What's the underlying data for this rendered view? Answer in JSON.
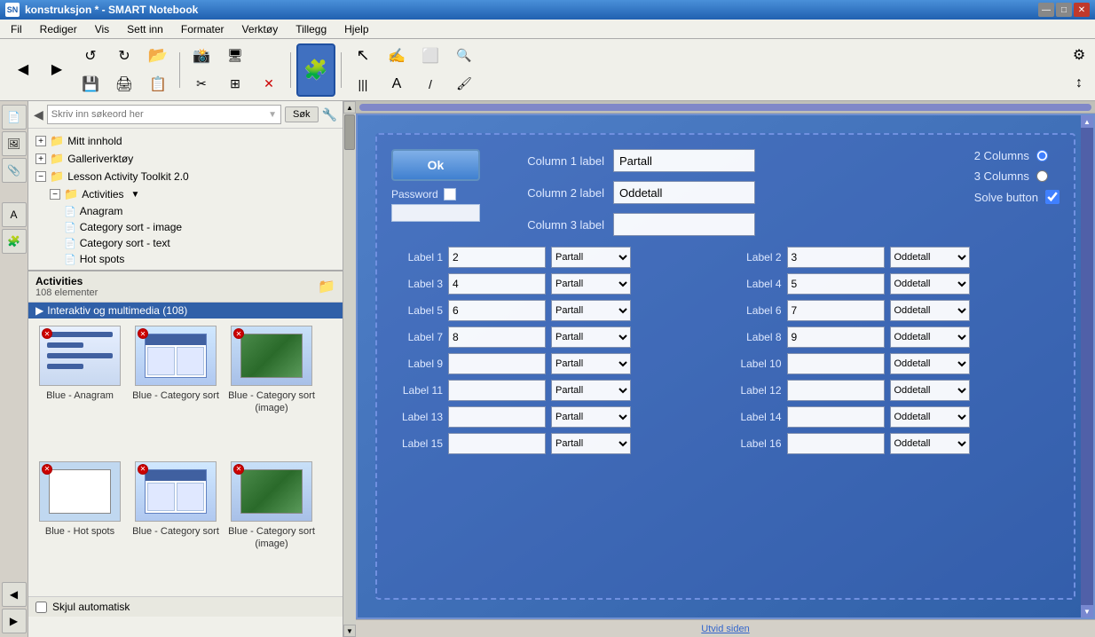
{
  "window": {
    "title": "konstruksjon * - SMART Notebook",
    "icon_label": "SN"
  },
  "titlebar": {
    "minimize_label": "—",
    "maximize_label": "□",
    "close_label": "✕"
  },
  "menu": {
    "items": [
      "Fil",
      "Rediger",
      "Vis",
      "Sett inn",
      "Formater",
      "Verktøy",
      "Tillegg",
      "Hjelp"
    ]
  },
  "toolbar": {
    "back_label": "◀",
    "forward_label": "▶",
    "nav_icons": [
      "↺",
      "↻",
      "📁",
      "💾",
      "✉",
      "🖨",
      "✂",
      "📋",
      "❌",
      "⊞",
      "✕"
    ],
    "tool_icons": [
      "↗",
      "✋",
      "⊕",
      "✎",
      "≡",
      "🖊",
      "A",
      "✎",
      "⚡"
    ],
    "right_icons": [
      "⚙",
      "↕"
    ]
  },
  "search": {
    "placeholder": "Skriv inn søkeord her",
    "button_label": "Søk",
    "wrench_label": "🔧"
  },
  "tree": {
    "items": [
      {
        "label": "Mitt innhold",
        "level": 0,
        "type": "folder",
        "expanded": true
      },
      {
        "label": "Galleriverktøy",
        "level": 0,
        "type": "folder",
        "expanded": false
      },
      {
        "label": "Lesson Activity Toolkit 2.0",
        "level": 0,
        "type": "folder",
        "expanded": true
      },
      {
        "label": "Activities",
        "level": 1,
        "type": "folder-special",
        "expanded": true
      },
      {
        "label": "Anagram",
        "level": 2,
        "type": "file"
      },
      {
        "label": "Category sort - image",
        "level": 2,
        "type": "file"
      },
      {
        "label": "Category sort - text",
        "level": 2,
        "type": "file"
      },
      {
        "label": "Hot spots",
        "level": 2,
        "type": "file"
      }
    ]
  },
  "activities_panel": {
    "title": "Activities",
    "count": "108 elementer",
    "category": "Interaktiv og multimedia (108)",
    "thumbnails": [
      {
        "label": "Blue - Anagram",
        "type": "anagram"
      },
      {
        "label": "Blue - Category sort",
        "type": "catgsort"
      },
      {
        "label": "Blue - Category sort (image)",
        "type": "catgsort-img"
      },
      {
        "label": "Blue - Hot spots",
        "type": "hotspots"
      },
      {
        "label": "Blue - Category sort",
        "type": "catgsort2"
      },
      {
        "label": "Blue - Category sort (image)",
        "type": "catgsort-img2"
      }
    ],
    "autohide_label": "Skjul automatisk"
  },
  "canvas": {
    "ok_button": "Ok",
    "password_label": "Password",
    "column1_label": "Column 1 label",
    "column2_label": "Column 2 label",
    "column3_label": "Column 3 label",
    "column1_value": "Partall",
    "column2_value": "Oddetall",
    "column3_value": "",
    "two_columns_label": "2 Columns",
    "three_columns_label": "3 Columns",
    "solve_button_label": "Solve button",
    "labels": [
      {
        "name": "Label 1",
        "value": "2",
        "category": "Partall"
      },
      {
        "name": "Label 2",
        "value": "3",
        "category": "Oddetall"
      },
      {
        "name": "Label 3",
        "value": "4",
        "category": "Partall"
      },
      {
        "name": "Label 4",
        "value": "5",
        "category": "Oddetall"
      },
      {
        "name": "Label 5",
        "value": "6",
        "category": "Partall"
      },
      {
        "name": "Label 6",
        "value": "7",
        "category": "Oddetall"
      },
      {
        "name": "Label 7",
        "value": "8",
        "category": "Partall"
      },
      {
        "name": "Label 8",
        "value": "9",
        "category": "Oddetall"
      },
      {
        "name": "Label 9",
        "value": "",
        "category": "Partall"
      },
      {
        "name": "Label 10",
        "value": "",
        "category": "Oddetall"
      },
      {
        "name": "Label 11",
        "value": "",
        "category": "Partall"
      },
      {
        "name": "Label 12",
        "value": "",
        "category": "Oddetall"
      },
      {
        "name": "Label 13",
        "value": "",
        "category": "Partall"
      },
      {
        "name": "Label 14",
        "value": "",
        "category": "Oddetall"
      },
      {
        "name": "Label 15",
        "value": "",
        "category": "Partall"
      },
      {
        "name": "Label 16",
        "value": "",
        "category": "Oddetall"
      }
    ]
  },
  "bottom_status": {
    "label": "Utvid siden"
  }
}
